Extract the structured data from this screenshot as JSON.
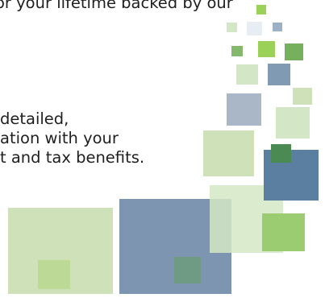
{
  "text": {
    "line_top": "or your lifetime backed by our",
    "line_1": "detailed,",
    "line_2": "ation with your",
    "line_3": "t and tax benefits."
  },
  "decor": {
    "palette": {
      "light_green": "#cfe1b8",
      "pale_blue": "#e7edf3",
      "blue": "#7d95b0",
      "dark_blue": "#5b7fa0",
      "green": "#76b05c",
      "lime": "#9bd159",
      "mint": "#d3e7c6",
      "olive": "#b8d88f",
      "gray_blue": "#a9b7c7"
    }
  }
}
